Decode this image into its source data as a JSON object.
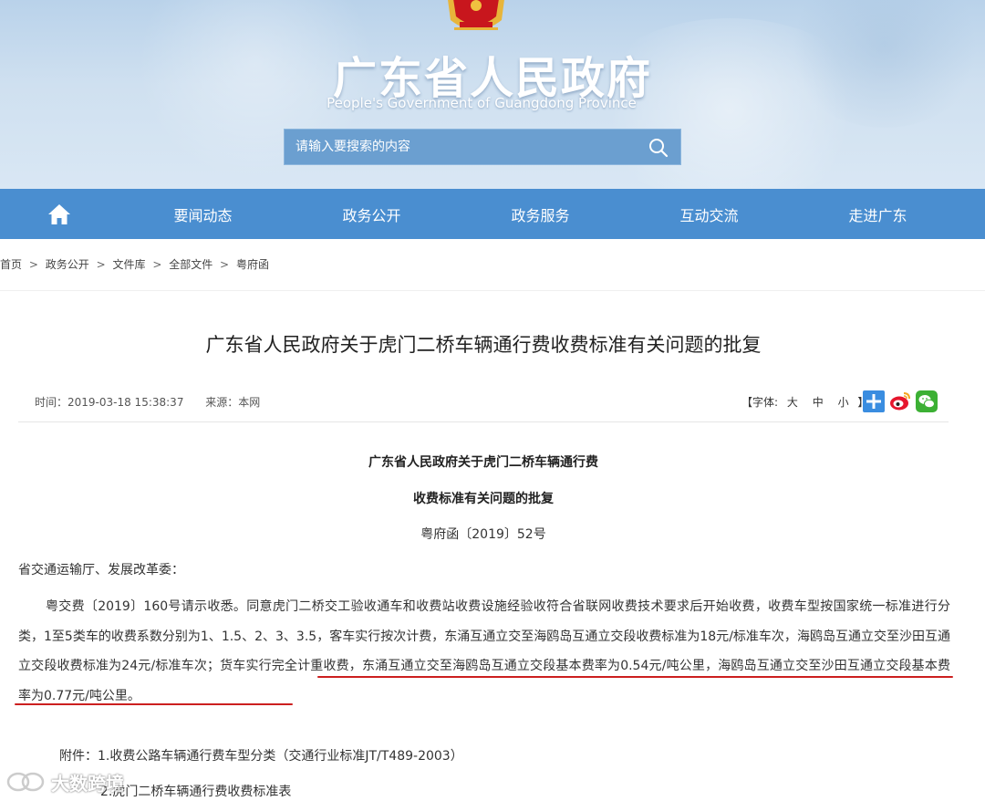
{
  "header": {
    "site_title": "广东省人民政府",
    "site_subtitle": "People's Government of Guangdong Province",
    "search_placeholder": "请输入要搜索的内容"
  },
  "nav": {
    "home_icon": "home-icon",
    "items": [
      "要闻动态",
      "政务公开",
      "政务服务",
      "互动交流",
      "走进广东"
    ]
  },
  "breadcrumb": [
    "首页",
    "政务公开",
    "文件库",
    "全部文件",
    "粤府函"
  ],
  "breadcrumb_separator": ">",
  "article": {
    "title": "广东省人民政府关于虎门二桥车辆通行费收费标准有关问题的批复",
    "time_label": "时间：2019-03-18 15:38:37",
    "source_label": "来源：本网",
    "font_size_label": "【字体:",
    "font_large": "大",
    "font_medium": "中",
    "font_small": "小",
    "font_close": "】",
    "share_icons": [
      "plus-share-icon",
      "weibo-icon",
      "wechat-icon"
    ],
    "heading_line1": "广东省人民政府关于虎门二桥车辆通行费",
    "heading_line2": "收费标准有关问题的批复",
    "doc_number": "粤府函〔2019〕52号",
    "recipient": "省交通运输厅、发展改革委：",
    "body_part1": "粤交费〔2019〕160号请示收悉。同意虎门二桥交工验收通车和收费站收费设施经验收符合省联网收费技术要求后开始收费，收费车型按国家统一标准进行分类，1至5类车的收费系数分别为1、1.5、2、3、3.5，客车实行按次计费，东涌互通立交至海鸥岛互通立交段收费标准为18元/标准车次，海鸥岛互通立交至沙田互通立交段收费标准为24元/标准车次；",
    "body_part2": "货车实行完全计重收费，东涌互通立交至海鸥岛互通立交段基本费率为0.54元/吨公里，海鸥岛互通立交至沙田互通立交段基本费率为0.77元/吨公里。",
    "attachment1": "附件：1.收费公路车辆通行费车型分类（交通行业标准JT/T489-2003）",
    "attachment2": "2.虎门二桥车辆通行费收费标准表"
  },
  "watermark": "大数跨境",
  "colors": {
    "nav_bg": "#4a8ed0",
    "banner_bg": "#c6dcef",
    "search_bg": "#6b9fd0",
    "underline": "#cc1f1f",
    "emblem_red": "#c8161d",
    "emblem_gold": "#f0c040"
  }
}
